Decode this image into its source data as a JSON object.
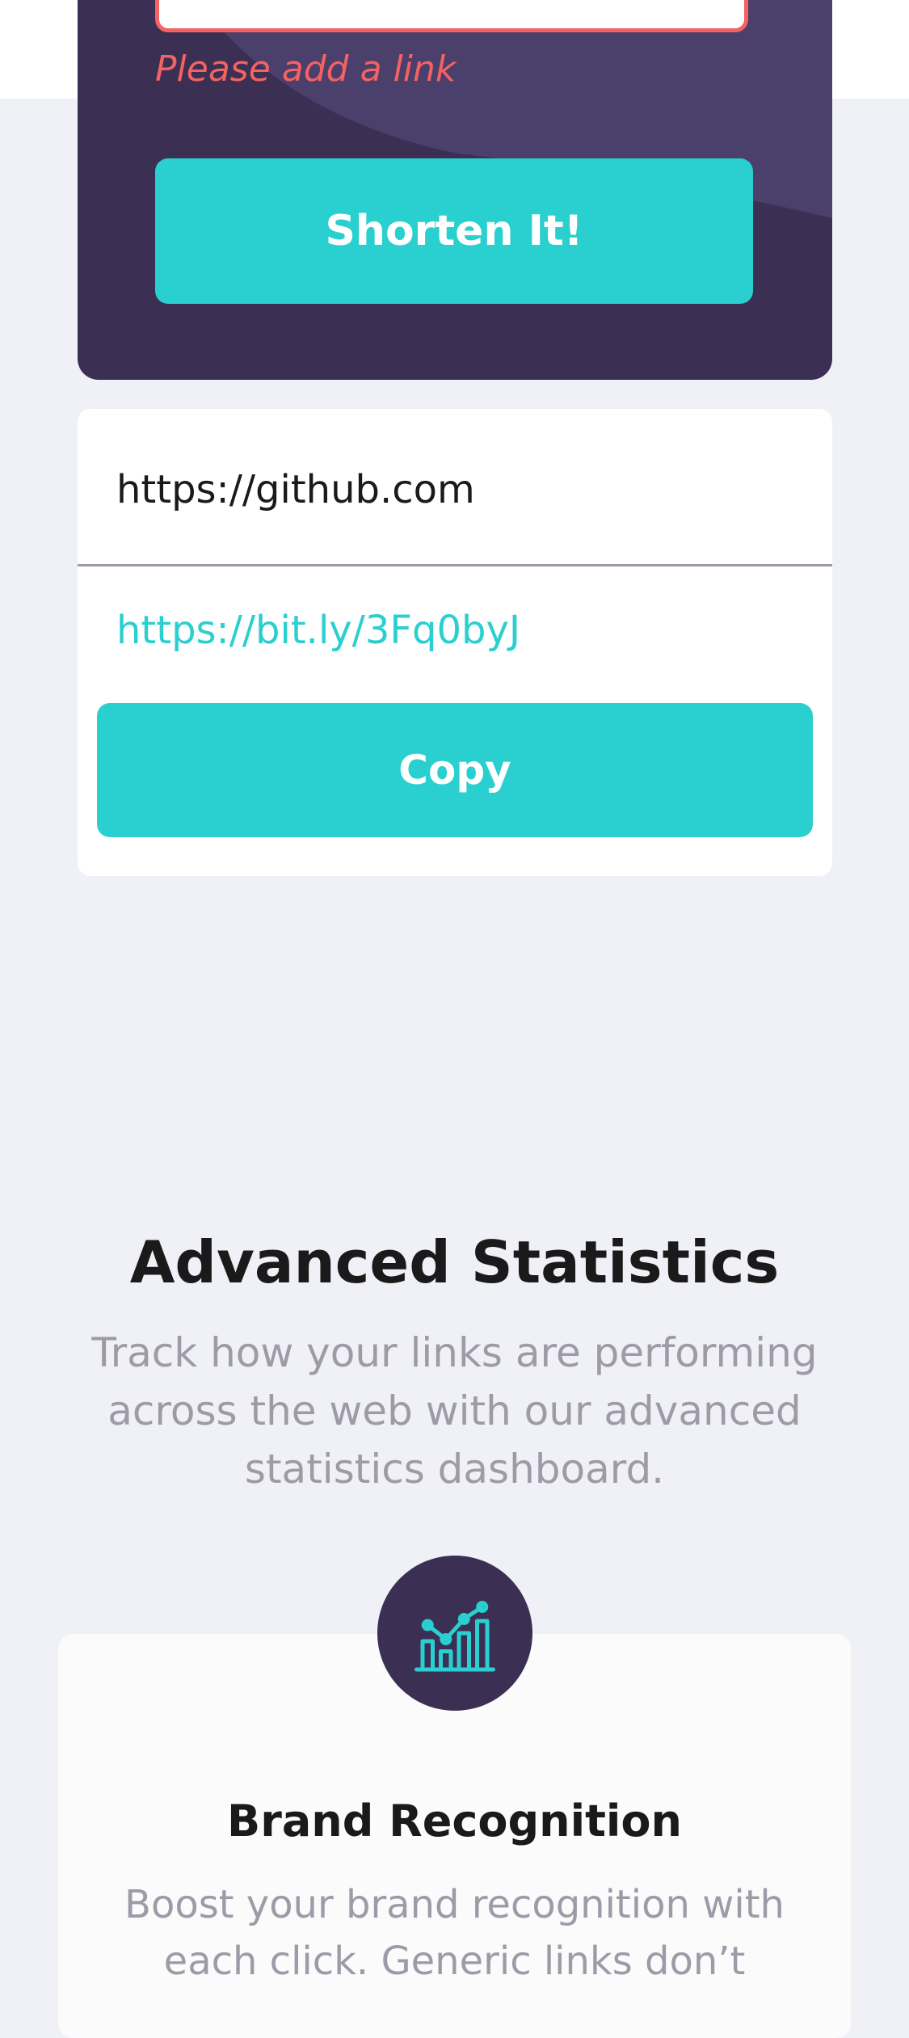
{
  "shortener": {
    "input_value": "",
    "error_message": "Please add a link",
    "submit_label": "Shorten It!"
  },
  "result": {
    "original_url": "https://github.com",
    "short_url": "https://bit.ly/3Fq0byJ",
    "copy_label": "Copy"
  },
  "statistics": {
    "title": "Advanced Statistics",
    "description": "Track how your links are performing across the web with our advanced statistics dashboard."
  },
  "feature": {
    "icon": "brand-recognition-chart-icon",
    "title": "Brand Recognition",
    "description": "Boost your brand recognition with each click. Generic links don’t"
  },
  "colors": {
    "primary_cyan": "#2acfcf",
    "dark_violet": "#3b3054",
    "error_red": "#f46262",
    "grayish_violet": "#9e9aa7",
    "background": "#f0f1f6"
  }
}
